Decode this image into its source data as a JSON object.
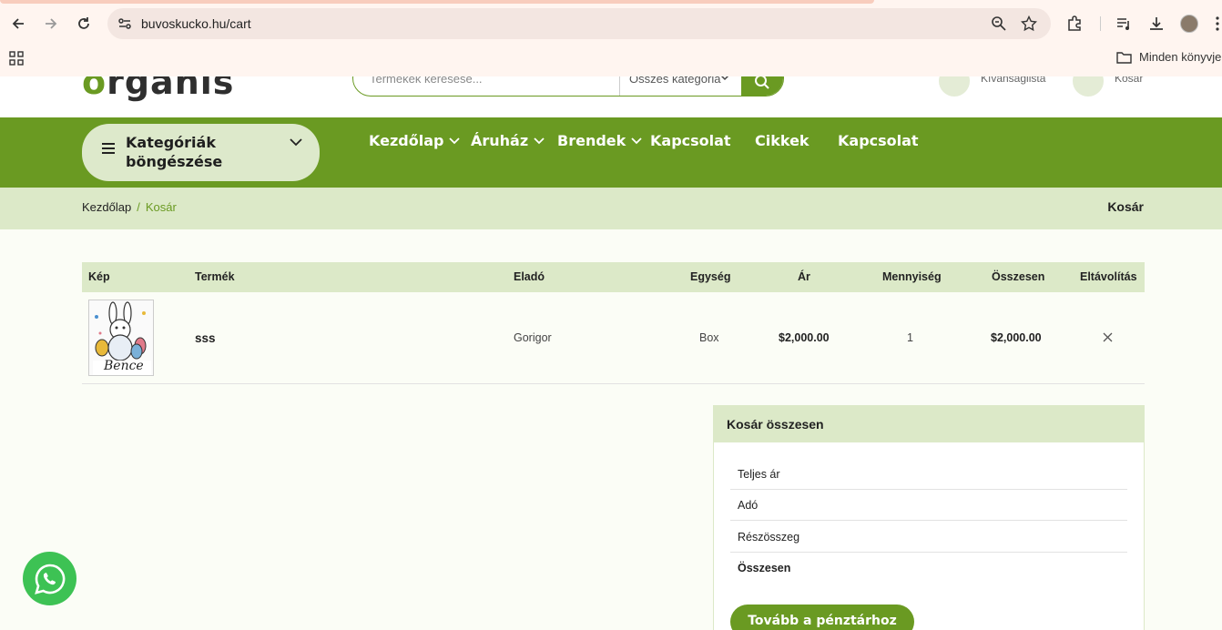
{
  "browser": {
    "url": "buvoskucko.hu/cart",
    "bookmarks_folder": "Minden könyvjelz"
  },
  "header": {
    "logo": "organis",
    "search_placeholder": "Termékek keresése...",
    "search_category": "Összes kategória",
    "wishlist_label": "Kívánságlista",
    "cart_label": "Kosár"
  },
  "nav": {
    "categories_label": "Kategóriák böngészése",
    "items": [
      {
        "label": "Kezdőlap",
        "dropdown": true
      },
      {
        "label": "Áruház",
        "dropdown": true
      },
      {
        "label": "Brendek",
        "dropdown": true
      },
      {
        "label": "Kapcsolat",
        "dropdown": false
      },
      {
        "label": "Cikkek",
        "dropdown": false
      },
      {
        "label": "Kapcsolat",
        "dropdown": false
      }
    ]
  },
  "breadcrumb": {
    "home": "Kezdőlap",
    "separator": "/",
    "current": "Kosár",
    "page_title": "Kosár"
  },
  "cart_table": {
    "headers": [
      "Kép",
      "Termék",
      "Eladó",
      "Egység",
      "Ár",
      "Mennyiség",
      "Összesen",
      "Eltávolítás"
    ],
    "rows": [
      {
        "image_caption": "Bence",
        "product": "sss",
        "seller": "Gorigor",
        "unit": "Box",
        "price": "$2,000.00",
        "quantity": "1",
        "total": "$2,000.00",
        "remove_icon": "close-icon"
      }
    ]
  },
  "totals": {
    "title": "Kosár összesen",
    "rows": [
      "Teljes ár",
      "Adó",
      "Részösszeg",
      "Összesen"
    ],
    "checkout_label": "Tovább a pénztárhoz"
  },
  "colors": {
    "brand_green": "#6a9a22",
    "light_green": "#dce9c8",
    "whatsapp": "#3dc254"
  }
}
